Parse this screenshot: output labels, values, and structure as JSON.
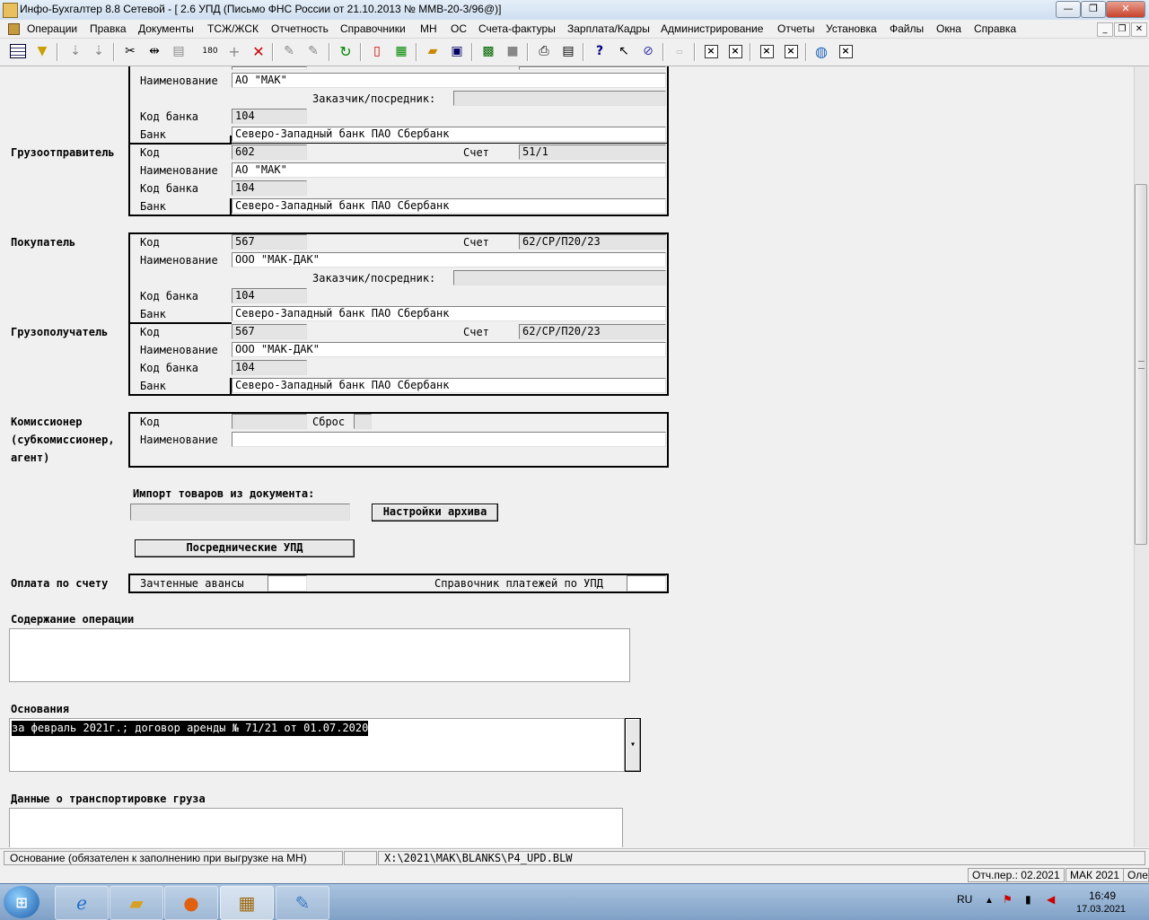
{
  "window": {
    "title": "Инфо-Бухгалтер 8.8 Сетевой - [  2.6 УПД (Письмо ФНС России от 21.10.2013 № ММВ-20-3/96@)]",
    "minimize": "—",
    "maximize": "❐",
    "close": "✕"
  },
  "menu": [
    "Операции",
    "Правка",
    "Документы",
    "ТСЖ/ЖСК",
    "Отчетность",
    "Справочники",
    "МН",
    "ОС",
    "Счета-фактуры",
    "Зарплата/Кадры",
    "Администрирование",
    "Отчеты",
    "Установка",
    "Файлы",
    "Окна",
    "Справка"
  ],
  "mdi": {
    "minimize": "_",
    "restore": "❐",
    "close": "✕"
  },
  "toolbar_icons": [
    "table-icon",
    "filter-icon",
    "sort-asc-icon",
    "sort-desc-icon",
    "cut-icon",
    "column-icon",
    "paste-icon",
    "rotate-180-icon",
    "add-icon",
    "delete-icon",
    "link-icon",
    "unlink-icon",
    "refresh-icon",
    "pdf-icon",
    "calculator-icon",
    "open-folder-icon",
    "save-icon",
    "import-icon",
    "export-icon",
    "print-icon",
    "preview-icon",
    "help-icon",
    "context-help-icon",
    "compass-icon",
    "report-icon",
    "close-box-icon",
    "close-box-icon",
    "close-box-icon",
    "close-box-icon",
    "globe-icon",
    "close-box-icon"
  ],
  "form": {
    "seller_block": {
      "name_label": "Наименование",
      "name_value": "АО \"МАК\"",
      "customer_label": "Заказчик/посредник:",
      "customer_value": "",
      "bank_code_label": "Код банка",
      "bank_code_value": "104",
      "bank_label": "Банк",
      "bank_value": "Северо-Западный банк ПАО Сбербанк"
    },
    "shipper": {
      "section_label": "Грузоотправитель",
      "code_label": "Код",
      "code_value": "602",
      "account_label": "Счет",
      "account_value": "51/1",
      "name_label": "Наименование",
      "name_value": "АО \"МАК\"",
      "bank_code_label": "Код банка",
      "bank_code_value": "104",
      "bank_label": "Банк",
      "bank_value": "Северо-Западный банк ПАО Сбербанк"
    },
    "buyer": {
      "section_label": "Покупатель",
      "code_label": "Код",
      "code_value": "567",
      "account_label": "Счет",
      "account_value": "62/СР/П20/23",
      "name_label": "Наименование",
      "name_value": "ООО \"МАК-ДАК\"",
      "customer_label": "Заказчик/посредник:",
      "customer_value": "",
      "bank_code_label": "Код банка",
      "bank_code_value": "104",
      "bank_label": "Банк",
      "bank_value": "Северо-Западный банк ПАО Сбербанк"
    },
    "consignee": {
      "section_label": "Грузополучатель",
      "code_label": "Код",
      "code_value": "567",
      "account_label": "Счет",
      "account_value": "62/СР/П20/23",
      "name_label": "Наименование",
      "name_value": "ООО \"МАК-ДАК\"",
      "bank_code_label": "Код банка",
      "bank_code_value": "104",
      "bank_label": "Банк",
      "bank_value": "Северо-Западный банк ПАО Сбербанк"
    },
    "commissioner": {
      "section_label_1": "Комиссионер",
      "section_label_2": "(субкомиссионер,",
      "section_label_3": "агент)",
      "code_label": "Код",
      "code_value": "",
      "reset_label": "Сброс",
      "name_label": "Наименование",
      "name_value": ""
    },
    "import": {
      "label": "Импорт товаров из документа:",
      "value": "",
      "archive_button": "Настройки архива"
    },
    "intermediary_button": "Посреднические УПД",
    "payment": {
      "section_label": "Оплата по счету",
      "advances_label": "Зачтенные авансы",
      "advances_value": "",
      "payments_ref_label": "Справочник платежей по УПД",
      "payments_ref_value": ""
    },
    "operation": {
      "label": "Содержание операции",
      "value": ""
    },
    "basis": {
      "label": "Основания",
      "value": "за февраль 2021г.; договор аренды  № 71/21 от 01.07.2020",
      "dropdown": "▾"
    },
    "transport": {
      "label": "Данные о транспортировке груза",
      "value": ""
    }
  },
  "status": {
    "hint": "Основание (обязателен к заполнению при выгрузке на МН)",
    "empty": "",
    "path": "X:\\2021\\MAK\\BLANKS\\P4_UPD.BLW",
    "period": "Отч.пер.: 02.2021",
    "org": "МАК 2021",
    "user": "Оле"
  },
  "taskbar": {
    "lang": "RU",
    "time": "16:49",
    "date": "17.03.2021"
  }
}
